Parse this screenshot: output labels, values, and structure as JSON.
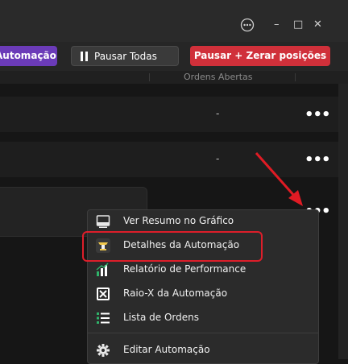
{
  "window": {
    "more_icon": "ellipsis-circle-icon",
    "minimize_glyph": "–",
    "maximize_glyph": "□",
    "close_glyph": "✕"
  },
  "toolbar": {
    "automation_label": "Automação",
    "pause_all_label": "Pausar Todas",
    "pause_reset_label": "Pausar + Zerar posições"
  },
  "table": {
    "column_header": "Ordens Abertas",
    "rows": [
      {
        "open_orders": "-",
        "menu_glyph": "•••"
      },
      {
        "open_orders": "-",
        "menu_glyph": "•••"
      },
      {
        "open_orders": "",
        "menu_glyph": "•••"
      }
    ]
  },
  "context_menu": {
    "items": [
      {
        "label": "Ver Resumo no Gráfico",
        "icon": "chart-window-icon"
      },
      {
        "label": "Detalhes da Automação",
        "icon": "automation-details-icon",
        "highlighted": true
      },
      {
        "label": "Relatório de Performance",
        "icon": "performance-bars-icon"
      },
      {
        "label": "Raio-X da Automação",
        "icon": "xray-icon"
      },
      {
        "label": "Lista de Ordens",
        "icon": "list-icon"
      },
      {
        "label": "Editar Automação",
        "icon": "gear-icon"
      }
    ]
  },
  "colors": {
    "automation_button": "#6b3bb8",
    "danger_button": "#d0303a",
    "highlight": "#dd1e2a",
    "arrow": "#e01b24"
  }
}
